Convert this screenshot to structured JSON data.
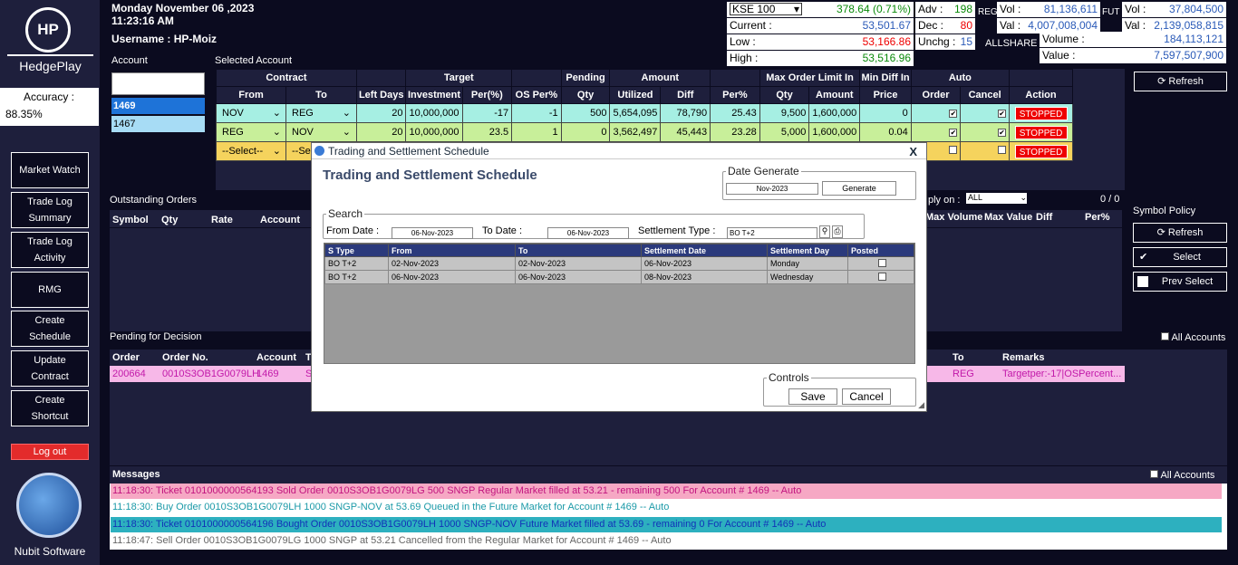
{
  "header": {
    "date": "Monday November 06 ,2023",
    "time": "11:23:16 AM",
    "username": "Username : HP-Moiz"
  },
  "brand": {
    "logo": "HP",
    "name": "HedgePlay",
    "footer": "Nubit Software"
  },
  "accuracy": {
    "label": "Accuracy :",
    "value": "88.35%"
  },
  "sidebar": {
    "items": [
      {
        "label": "Market Watch"
      },
      {
        "label": "Trade Log Summary"
      },
      {
        "label": "Trade Log Activity"
      },
      {
        "label": "RMG"
      },
      {
        "label": "Create Schedule"
      },
      {
        "label": "Update Contract"
      },
      {
        "label": "Create Shortcut"
      }
    ],
    "logout": "Log out"
  },
  "ticker": {
    "index": "KSE 100",
    "change": "378.64 (0.71%)",
    "current_label": "Current :",
    "current": "53,501.67",
    "low_label": "Low :",
    "low": "53,166.86",
    "high_label": "High :",
    "high": "53,516.96",
    "adv_label": "Adv :",
    "adv": "198",
    "dec_label": "Dec :",
    "dec": "80",
    "unchg_label": "Unchg :",
    "unchg": "15",
    "reg": "REG",
    "reg_vol_label": "Vol :",
    "reg_vol": "81,136,611",
    "reg_val_label": "Val :",
    "reg_val": "4,007,008,004",
    "fut": "FUT",
    "fut_vol_label": "Vol :",
    "fut_vol": "37,804,500",
    "fut_val_label": "Val :",
    "fut_val": "2,139,058,815",
    "allshare": "ALLSHARE",
    "volume_label": "Volume :",
    "volume": "184,113,121",
    "value_label": "Value :",
    "value": "7,597,507,900"
  },
  "account": {
    "label": "Account",
    "items": [
      "1469",
      "1467"
    ]
  },
  "selected_account": {
    "label": "Selected Account",
    "group_headers": [
      "Contract",
      "Target",
      "Pending",
      "Amount",
      "Max Order Limit In",
      "Min Diff In",
      "Auto"
    ],
    "columns": [
      "From",
      "To",
      "Left Days",
      "Investment",
      "Per(%)",
      "OS Per%",
      "Qty",
      "Utilized",
      "Diff",
      "Per%",
      "Qty",
      "Amount",
      "Price",
      "Order",
      "Cancel",
      "Action"
    ],
    "rows": [
      {
        "from": "NOV",
        "to": "REG",
        "left": "20",
        "inv": "10,000,000",
        "per": "-17",
        "os": "-1",
        "qty": "500",
        "util": "5,654,095",
        "diff": "78,790",
        "perp": "25.43",
        "mqty": "9,500",
        "mamt": "1,600,000",
        "price": "0",
        "action": "STOPPED"
      },
      {
        "from": "REG",
        "to": "NOV",
        "left": "20",
        "inv": "10,000,000",
        "per": "23.5",
        "os": "1",
        "qty": "0",
        "util": "3,562,497",
        "diff": "45,443",
        "perp": "23.28",
        "mqty": "5,000",
        "mamt": "1,600,000",
        "price": "0.04",
        "action": "STOPPED"
      },
      {
        "from": "--Select--",
        "to": "--Se",
        "action": "STOPPED"
      }
    ]
  },
  "right": {
    "refresh": "Refresh",
    "symbol_policy": "Symbol Policy",
    "refresh2": "Refresh",
    "select": "Select",
    "prev_select": "Prev Select",
    "all_accounts": "All Accounts"
  },
  "outstanding": {
    "title": "Outstanding Orders",
    "columns": [
      "Symbol",
      "Qty",
      "Rate",
      "Account"
    ],
    "right_columns": [
      "Max Volume",
      "Max Value",
      "Diff",
      "Per%"
    ],
    "apply_on": "ply on :",
    "apply_value": "ALL",
    "count": "0 / 0"
  },
  "pending": {
    "title": "Pending for Decision",
    "columns": [
      "Order",
      "Order No.",
      "Account",
      "T"
    ],
    "right_columns": [
      "To",
      "Remarks"
    ],
    "row": {
      "order": "200664",
      "order_no": "0010S3OB1G0079LH",
      "account": "1469",
      "t": "S",
      "to": "REG",
      "remarks": "Targetper:-17|OSPercent..."
    }
  },
  "messages": {
    "title": "Messages",
    "all_accounts": "All Accounts",
    "items": [
      "11:18:30: Ticket 0101000000564193 Sold Order 0010S3OB1G0079LG 500 SNGP Regular Market filled at 53.21 - remaining 500 For Account # 1469 -- Auto",
      "11:18:30: Buy Order 0010S3OB1G0079LH 1000 SNGP-NOV at 53.69 Queued in the Future Market for Account # 1469 -- Auto",
      "11:18:30: Ticket 0101000000564196 Bought Order 0010S3OB1G0079LH 1000 SNGP-NOV Future Market filled at 53.69 - remaining 0 For Account # 1469 -- Auto",
      "11:18:47: Sell Order 0010S3OB1G0079LG 1000 SNGP at 53.21 Cancelled from the Regular Market for Account # 1469 -- Auto"
    ]
  },
  "modal": {
    "window_title": "Trading and Settlement Schedule",
    "close": "X",
    "heading": "Trading and Settlement Schedule",
    "date_generate": "Date Generate",
    "gen_date": "Nov-2023",
    "generate": "Generate",
    "search": "Search",
    "from_label": "From Date :",
    "from": "06-Nov-2023",
    "to_label": "To Date :",
    "to": "06-Nov-2023",
    "settlement_label": "Settlement Type :",
    "settlement": "BO T+2",
    "columns": [
      "S Type",
      "From",
      "To",
      "Settlement Date",
      "Settlement Day",
      "Posted"
    ],
    "rows": [
      {
        "type": "BO T+2",
        "from": "02-Nov-2023",
        "to": "02-Nov-2023",
        "date": "06-Nov-2023",
        "day": "Monday"
      },
      {
        "type": "BO T+2",
        "from": "06-Nov-2023",
        "to": "06-Nov-2023",
        "date": "08-Nov-2023",
        "day": "Wednesday"
      }
    ],
    "controls": "Controls",
    "save": "Save",
    "cancel": "Cancel"
  }
}
